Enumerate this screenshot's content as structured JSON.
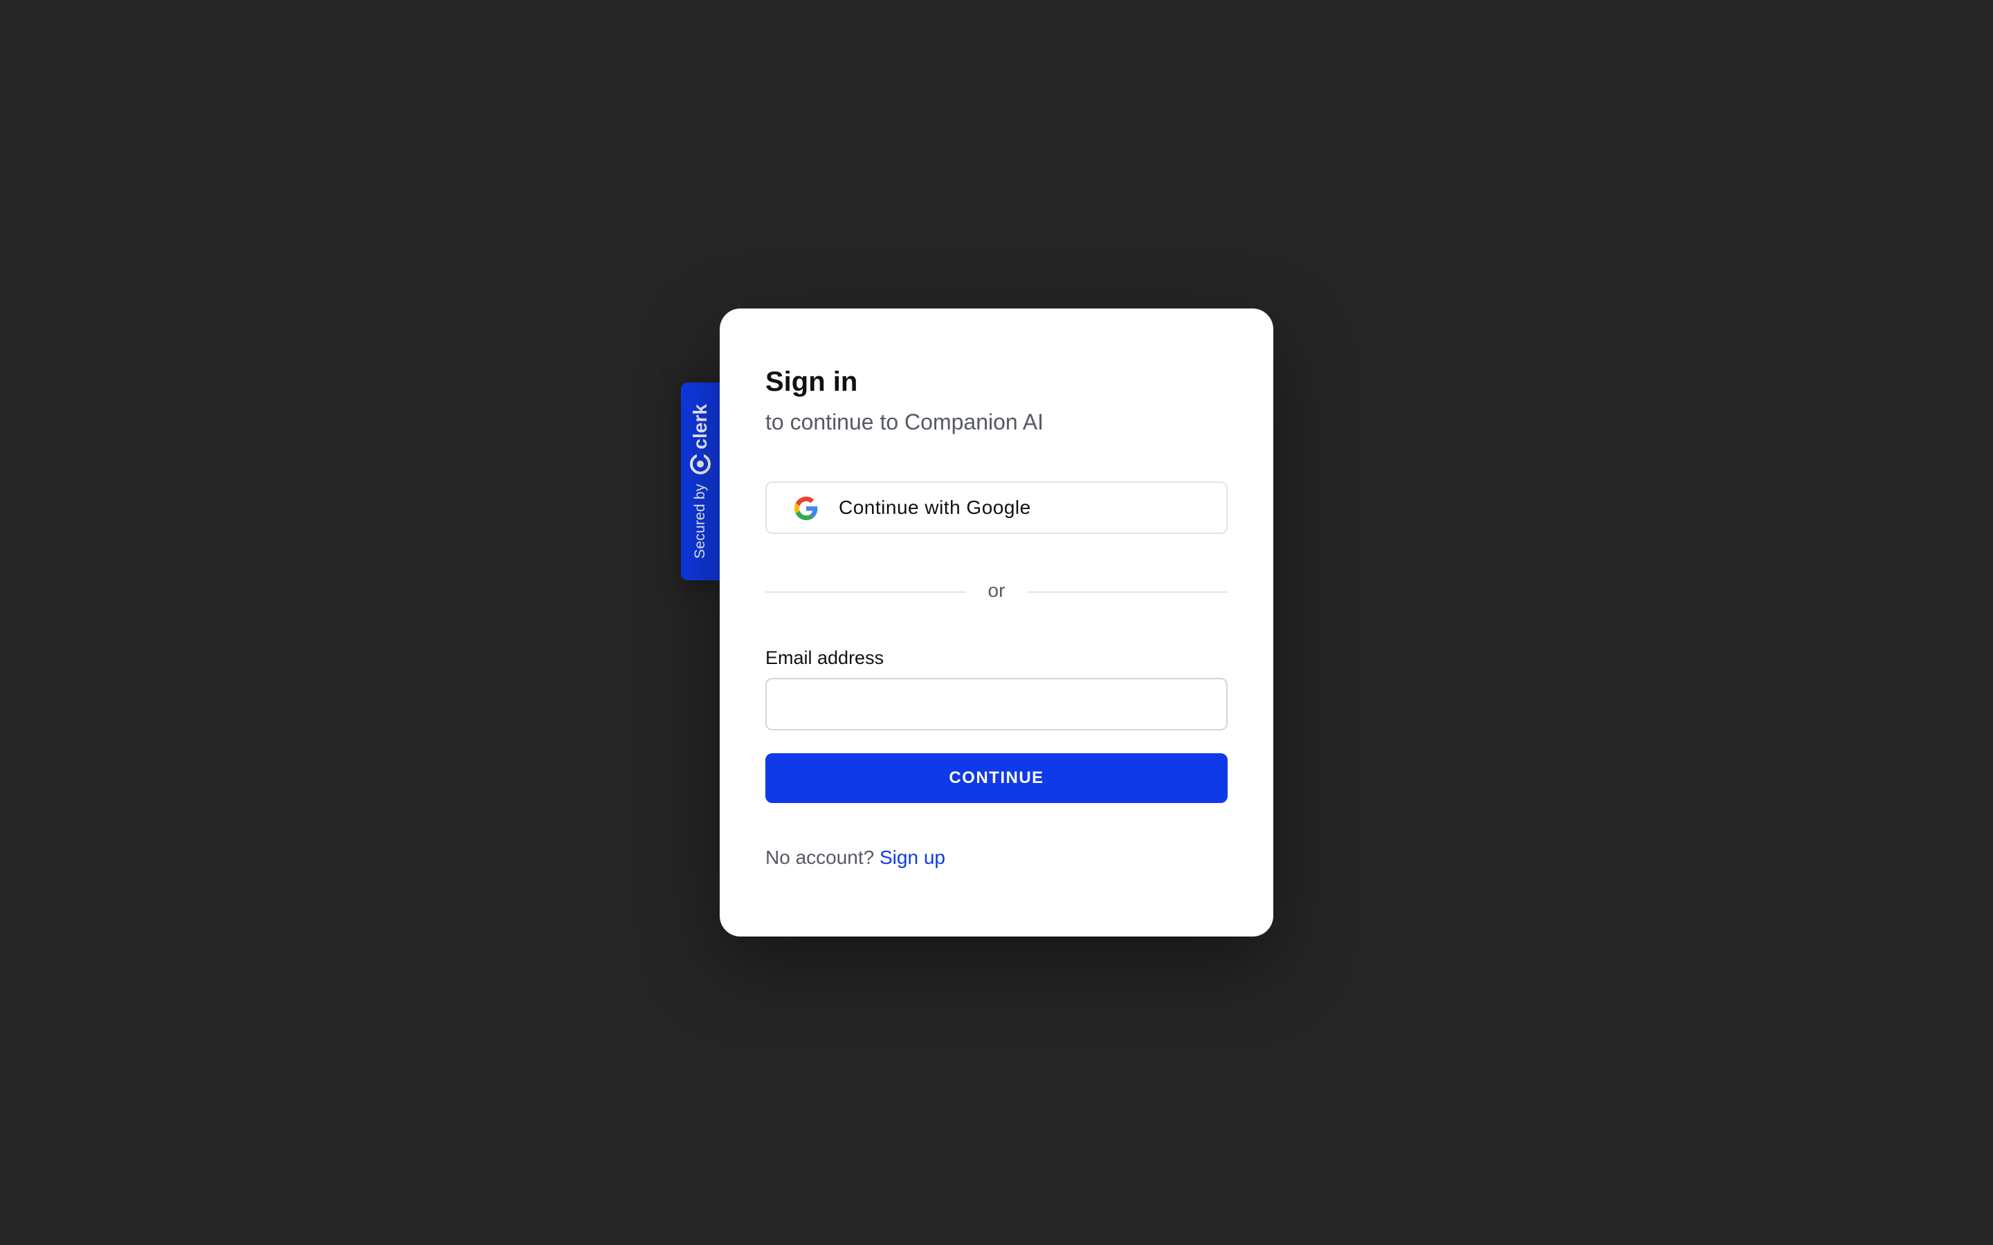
{
  "badge": {
    "secured_by": "Secured by",
    "brand": "clerk",
    "brand_icon": "clerk-logo-icon"
  },
  "signin": {
    "title": "Sign in",
    "subtitle": "to continue to Companion AI",
    "google_button_label": "Continue with Google",
    "google_icon": "google-icon",
    "divider_text": "or",
    "email_label": "Email address",
    "email_value": "",
    "email_placeholder": "",
    "continue_label": "CONTINUE",
    "footer_text": "No account?",
    "signup_label": "Sign up"
  },
  "colors": {
    "background": "#262626",
    "card": "#ffffff",
    "accent": "#103ae8",
    "text_primary": "#111111",
    "text_secondary": "#555a63"
  }
}
